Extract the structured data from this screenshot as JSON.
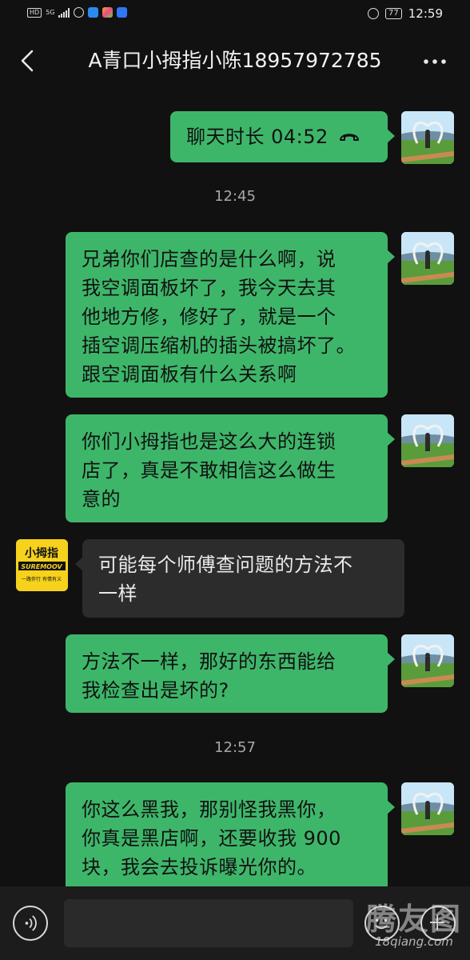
{
  "status_bar": {
    "left_badges": [
      "HD",
      "5G"
    ],
    "time": "12:59",
    "battery": "77",
    "icons": [
      "hd-icon",
      "signal-icon",
      "app-icon",
      "app-icon",
      "app-icon",
      "app-icon",
      "alarm-icon",
      "battery-icon"
    ]
  },
  "header": {
    "title": "A青口小拇指小陈18957972785",
    "back_icon": "chevron-left-icon",
    "more_icon": "more-dots-icon"
  },
  "messages": [
    {
      "side": "me",
      "type": "call",
      "text": "聊天时长 04:52",
      "icon": "phone-hangup-icon"
    },
    {
      "type": "timestamp",
      "text": "12:45"
    },
    {
      "side": "me",
      "lines": [
        "兄弟你们店查的是什么啊，说",
        "我空调面板坏了，我今天去其",
        "他地方修，修好了，就是一个",
        "插空调压缩机的插头被搞坏了。",
        "跟空调面板有什么关系啊"
      ]
    },
    {
      "side": "me",
      "lines": [
        "你们小拇指也是这么大的连锁",
        "店了，真是不敢相信这么做生",
        "意的"
      ]
    },
    {
      "side": "other",
      "lines": [
        "可能每个师傅查问题的方法不",
        "一样"
      ]
    },
    {
      "side": "me",
      "lines": [
        "方法不一样，那好的东西能给",
        "我检查出是坏的?"
      ]
    },
    {
      "type": "timestamp",
      "text": "12:57"
    },
    {
      "side": "me",
      "lines": [
        "你这么黑我，那别怪我黑你，",
        "你真是黑店啊，还要收我 900",
        "块，我会去投诉曝光你的。"
      ]
    }
  ],
  "other_avatar": {
    "brand_cn": "小拇指",
    "brand_en": "SUREMOOV",
    "slogan": "一路伴行  有情有义"
  },
  "input_bar": {
    "voice_icon": "voice-icon",
    "emoji_icon": "emoji-icon",
    "plus_icon": "plus-icon"
  },
  "watermark": {
    "text": "腾友图",
    "url": "18qiang.com"
  },
  "colors": {
    "background": "#111111",
    "my_bubble": "#3eb66a",
    "other_bubble": "#2c2c2c",
    "timestamp": "#a8a8a8"
  }
}
